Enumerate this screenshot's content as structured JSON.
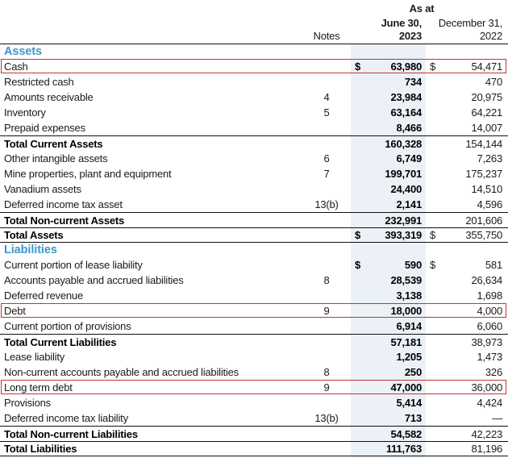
{
  "header": {
    "as_at": "As at",
    "notes_label": "Notes",
    "col1_line1": "June 30,",
    "col1_line2": "2023",
    "col2_line1": "December 31,",
    "col2_line2": "2022"
  },
  "colors": {
    "section_heading_blue": "#3F96CC",
    "column_highlight_blue": "#EBF1F6",
    "highlight_box_red": "#C53434",
    "rule_black": "#111111"
  },
  "rows": [
    {
      "type": "section",
      "label": "Assets"
    },
    {
      "type": "data",
      "label": "Cash",
      "notes": "",
      "d1": "$",
      "v1": "63,980",
      "d2": "$",
      "v2": "54,471",
      "redbox": true
    },
    {
      "type": "data",
      "label": "Restricted cash",
      "notes": "",
      "v1": "734",
      "v2": "470"
    },
    {
      "type": "data",
      "label": "Amounts receivable",
      "notes": "4",
      "v1": "23,984",
      "v2": "20,975"
    },
    {
      "type": "data",
      "label": "Inventory",
      "notes": "5",
      "v1": "63,164",
      "v2": "64,221"
    },
    {
      "type": "data",
      "label": "Prepaid expenses",
      "notes": "",
      "v1": "8,466",
      "v2": "14,007"
    },
    {
      "type": "total",
      "label": "Total Current Assets",
      "notes": "",
      "v1": "160,328",
      "v2": "154,144",
      "top": true
    },
    {
      "type": "data",
      "label": "Other intangible assets",
      "notes": "6",
      "v1": "6,749",
      "v2": "7,263"
    },
    {
      "type": "data",
      "label": "Mine properties, plant and equipment",
      "notes": "7",
      "v1": "199,701",
      "v2": "175,237"
    },
    {
      "type": "data",
      "label": "Vanadium assets",
      "notes": "",
      "v1": "24,400",
      "v2": "14,510"
    },
    {
      "type": "data",
      "label": "Deferred income tax asset",
      "notes": "13(b)",
      "v1": "2,141",
      "v2": "4,596"
    },
    {
      "type": "total",
      "label": "Total Non-current Assets",
      "notes": "",
      "v1": "232,991",
      "v2": "201,606",
      "top": true
    },
    {
      "type": "total",
      "label": "Total Assets",
      "notes": "",
      "d1": "$",
      "v1": "393,319",
      "d2": "$",
      "v2": "355,750",
      "top": true,
      "bottom": true
    },
    {
      "type": "section",
      "label": "Liabilities"
    },
    {
      "type": "data",
      "label": "Current portion of lease liability",
      "notes": "",
      "d1": "$",
      "v1": "590",
      "d2": "$",
      "v2": "581"
    },
    {
      "type": "data",
      "label": "Accounts payable and accrued liabilities",
      "notes": "8",
      "v1": "28,539",
      "v2": "26,634"
    },
    {
      "type": "data",
      "label": "Deferred revenue",
      "notes": "",
      "v1": "3,138",
      "v2": "1,698"
    },
    {
      "type": "data",
      "label": "Debt",
      "notes": "9",
      "v1": "18,000",
      "v2": "4,000",
      "redbox": true
    },
    {
      "type": "data",
      "label": "Current portion of provisions",
      "notes": "",
      "v1": "6,914",
      "v2": "6,060"
    },
    {
      "type": "total",
      "label": "Total Current Liabilities",
      "notes": "",
      "v1": "57,181",
      "v2": "38,973",
      "top": true
    },
    {
      "type": "data",
      "label": "Lease liability",
      "notes": "",
      "v1": "1,205",
      "v2": "1,473"
    },
    {
      "type": "data",
      "label": "Non-current accounts payable and accrued liabilities",
      "notes": "8",
      "v1": "250",
      "v2": "326"
    },
    {
      "type": "data",
      "label": "Long term debt",
      "notes": "9",
      "v1": "47,000",
      "v2": "36,000",
      "redbox": true
    },
    {
      "type": "data",
      "label": "Provisions",
      "notes": "",
      "v1": "5,414",
      "v2": "4,424"
    },
    {
      "type": "data",
      "label": "Deferred income tax liability",
      "notes": "13(b)",
      "v1": "713",
      "v2": "—"
    },
    {
      "type": "total",
      "label": "Total Non-current Liabilities",
      "notes": "",
      "v1": "54,582",
      "v2": "42,223",
      "top": true
    },
    {
      "type": "total",
      "label": "Total Liabilities",
      "notes": "",
      "v1": "111,763",
      "v2": "81,196",
      "top": true,
      "bottom": true
    }
  ]
}
